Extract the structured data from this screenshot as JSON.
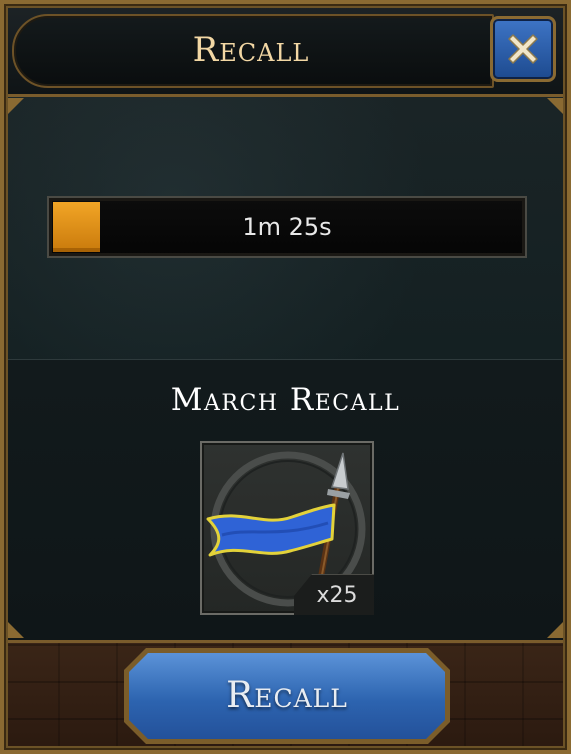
{
  "header": {
    "title": "Recall",
    "close_icon": "close-x-icon"
  },
  "timer": {
    "remaining_text": "1m 25s",
    "progress": 0.1,
    "fill_color": "#f2a526"
  },
  "item": {
    "section_title": "March Recall",
    "icon": "blue-banner-flag-icon",
    "quantity_text": "x25"
  },
  "footer": {
    "recall_button_label": "Recall",
    "button_color": "#2d64b0"
  },
  "colors": {
    "frame_bronze": "#8a6a32",
    "title_text": "#f2d7a4",
    "panel_bg": "#142022"
  }
}
